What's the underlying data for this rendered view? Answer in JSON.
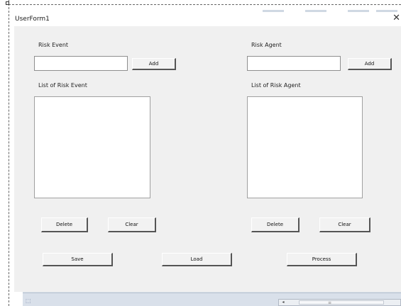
{
  "window": {
    "title": "UserForm1",
    "close_glyph": "✕"
  },
  "risk_event": {
    "label": "Risk Event",
    "input_value": "",
    "add_label": "Add",
    "list_label": "List of Risk Event",
    "delete_label": "Delete",
    "clear_label": "Clear"
  },
  "risk_agent": {
    "label": "Risk Agent",
    "input_value": "",
    "add_label": "Add",
    "list_label": "List of Risk Agent",
    "delete_label": "Delete",
    "clear_label": "Clear"
  },
  "actions": {
    "save_label": "Save",
    "load_label": "Load",
    "process_label": "Process"
  },
  "statusbar": {
    "left_arrow": "◂",
    "grip": "≡"
  },
  "colors": {
    "form_background": "#f0f0f0",
    "titlebar_background": "#ffffff",
    "statusbar_background": "#d9e0ea"
  }
}
